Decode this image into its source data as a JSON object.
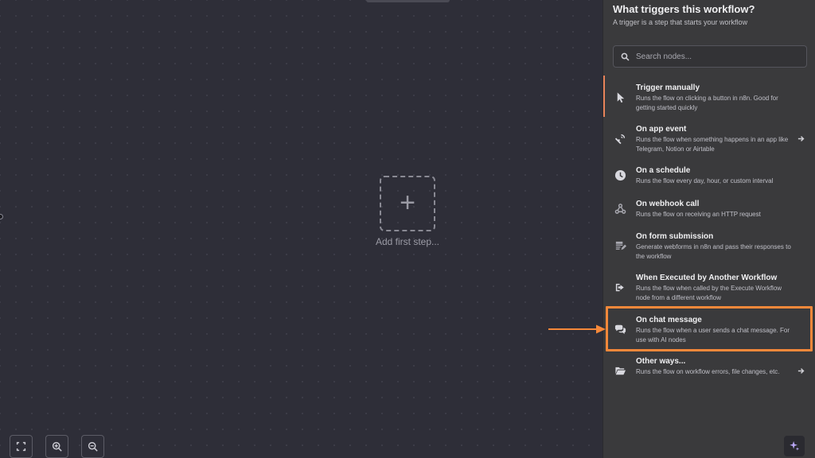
{
  "canvas": {
    "add_step_label": "Add first step..."
  },
  "panel": {
    "title": "What triggers this workflow?",
    "subtitle": "A trigger is a step that starts your workflow",
    "search_placeholder": "Search nodes...",
    "items": [
      {
        "name": "Trigger manually",
        "desc": "Runs the flow on clicking a button in n8n. Good for getting started quickly",
        "icon": "cursor-icon"
      },
      {
        "name": "On app event",
        "desc": "Runs the flow when something happens in an app like Telegram, Notion or Airtable",
        "icon": "satellite-icon"
      },
      {
        "name": "On a schedule",
        "desc": "Runs the flow every day, hour, or custom interval",
        "icon": "clock-icon"
      },
      {
        "name": "On webhook call",
        "desc": "Runs the flow on receiving an HTTP request",
        "icon": "webhook-icon"
      },
      {
        "name": "On form submission",
        "desc": "Generate webforms in n8n and pass their responses to the workflow",
        "icon": "form-icon"
      },
      {
        "name": "When Executed by Another Workflow",
        "desc": "Runs the flow when called by the Execute Workflow node from a different workflow",
        "icon": "sign-in-icon"
      },
      {
        "name": "On chat message",
        "desc": "Runs the flow when a user sends a chat message. For use with AI nodes",
        "icon": "chat-icon"
      },
      {
        "name": "Other ways...",
        "desc": "Runs the flow on workflow errors, file changes, etc.",
        "icon": "folder-open-icon"
      }
    ]
  },
  "colors": {
    "accent": "#f5883a",
    "active_bar": "#e8835a",
    "panel_bg": "#3a3a3c",
    "canvas_bg": "#2e2e38"
  }
}
